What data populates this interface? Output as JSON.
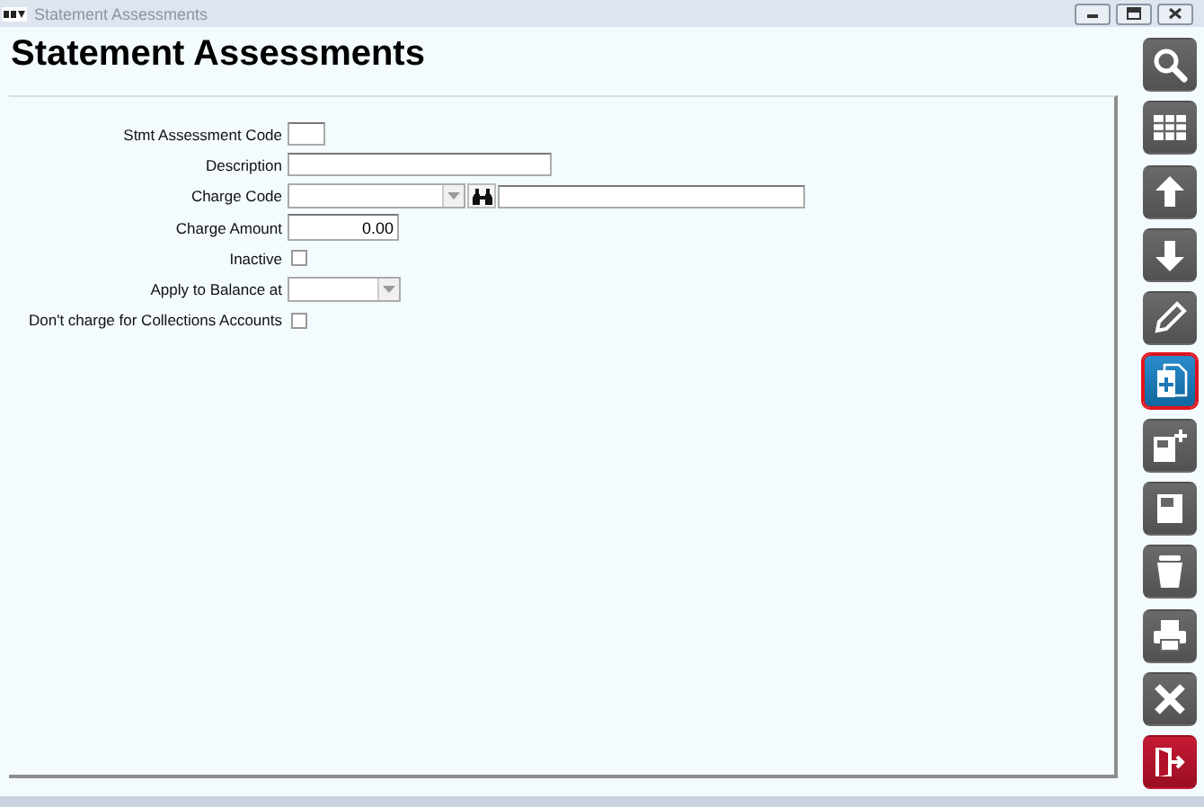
{
  "window": {
    "title": "Statement Assessments"
  },
  "heading": "Statement Assessments",
  "fields": [
    {
      "kind": "code",
      "label": "Stmt Assessment Code"
    },
    {
      "kind": "text",
      "label": "Description"
    },
    {
      "kind": "lookup",
      "label": "Charge Code"
    },
    {
      "kind": "number",
      "label": "Charge Amount",
      "value": "0.00"
    },
    {
      "kind": "checkbox",
      "label": "Inactive",
      "checked": false
    },
    {
      "kind": "select",
      "label": "Apply to Balance at"
    },
    {
      "kind": "checkbox",
      "label": "Don't charge for Collections Accounts",
      "checked": false
    }
  ],
  "toolbar": [
    {
      "kind": "search",
      "selected": false
    },
    {
      "kind": "grid",
      "selected": false
    },
    {
      "kind": "up",
      "selected": false
    },
    {
      "kind": "down",
      "selected": false
    },
    {
      "kind": "edit",
      "selected": false
    },
    {
      "kind": "new",
      "selected": true
    },
    {
      "kind": "save-new",
      "selected": false
    },
    {
      "kind": "save",
      "selected": false
    },
    {
      "kind": "delete",
      "selected": false
    },
    {
      "kind": "print",
      "selected": false
    },
    {
      "kind": "close",
      "selected": false
    },
    {
      "kind": "exit",
      "selected": false
    }
  ]
}
